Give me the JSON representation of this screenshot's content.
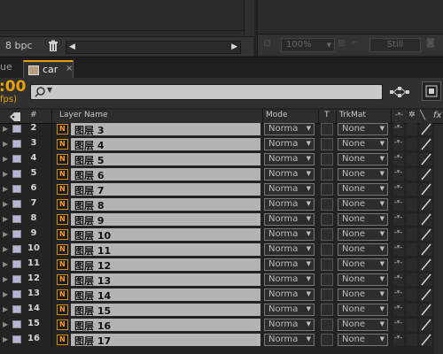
{
  "project_panel": {
    "bpc_label": "8 bpc"
  },
  "viewer_footer": {
    "zoom": "100%",
    "still": "Still"
  },
  "tabs": {
    "prev_tab_fragment": "ue",
    "active_tab": "car",
    "close": "×"
  },
  "timeline": {
    "timecode": ":00",
    "fps": "fps)",
    "search_placeholder": "",
    "columns": {
      "number": "#",
      "layer_name": "Layer Name",
      "mode": "Mode",
      "t": "T",
      "trkmat": "TrkMat"
    },
    "layers": [
      {
        "num": "2",
        "name": "图层 3"
      },
      {
        "num": "3",
        "name": "图层 4"
      },
      {
        "num": "4",
        "name": "图层 5"
      },
      {
        "num": "5",
        "name": "图层 6"
      },
      {
        "num": "6",
        "name": "图层 7"
      },
      {
        "num": "7",
        "name": "图层 8"
      },
      {
        "num": "8",
        "name": "图层 9"
      },
      {
        "num": "9",
        "name": "图层 10"
      },
      {
        "num": "10",
        "name": "图层 11"
      },
      {
        "num": "11",
        "name": "图层 12"
      },
      {
        "num": "12",
        "name": "图层 13"
      },
      {
        "num": "13",
        "name": "图层 14"
      },
      {
        "num": "14",
        "name": "图层 15"
      },
      {
        "num": "15",
        "name": "图层 16"
      },
      {
        "num": "16",
        "name": "图层 17"
      }
    ],
    "mode_value": "Norma",
    "trkmat_value": "None",
    "file_icon_text": "N"
  },
  "colors": {
    "accent": "#e8a200",
    "label_color": "#b4b4d8",
    "name_bar": "#b4b4b4"
  }
}
